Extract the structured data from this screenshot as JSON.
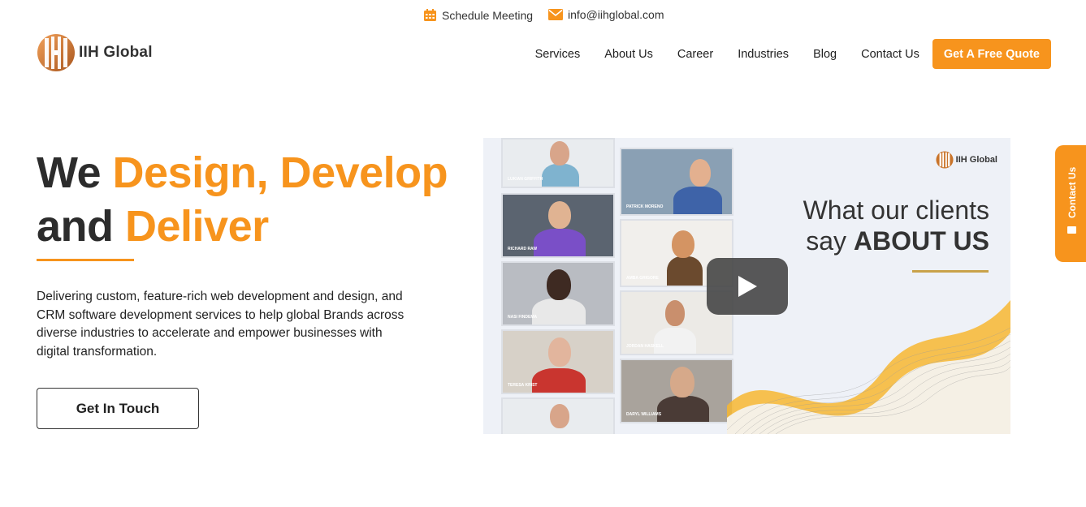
{
  "topbar": {
    "schedule_label": "Schedule Meeting",
    "schedule_icon": "calendar-icon",
    "email_label": "info@iihglobal.com",
    "email_icon": "envelope-icon"
  },
  "header": {
    "brand": "IIH Global",
    "nav": [
      "Services",
      "About Us",
      "Career",
      "Industries",
      "Blog",
      "Contact Us"
    ],
    "quote_button": "Get A Free Quote"
  },
  "hero": {
    "title_line1_plain": "We ",
    "title_line1_accent": "Design, Develop",
    "title_line2_plain": "and ",
    "title_line2_accent": "Deliver",
    "description": "Delivering custom, feature-rich web development and design, and CRM software development services to help global Brands across diverse industries to accelerate and empower businesses with digital transformation.",
    "cta_label": "Get In Touch"
  },
  "video": {
    "brand": "IIH Global",
    "heading_line1": "What our clients",
    "heading_line2_plain": "say ",
    "heading_line2_bold": "ABOUT US",
    "play_icon": "play-icon",
    "participants": [
      "LUKIAN GRIFFITH",
      "RICHARD RAW",
      "NASI FINDEMA",
      "TERESA KRIST",
      "PATRICK MORENO",
      "AMBA GRIGORE",
      "JORDAN HASKELL",
      "DARYL WILLIAMS"
    ]
  },
  "side_tab": {
    "label": "Contact Us",
    "icon": "envelope-icon"
  },
  "colors": {
    "accent": "#f7941d",
    "text": "#2c2c2c"
  }
}
